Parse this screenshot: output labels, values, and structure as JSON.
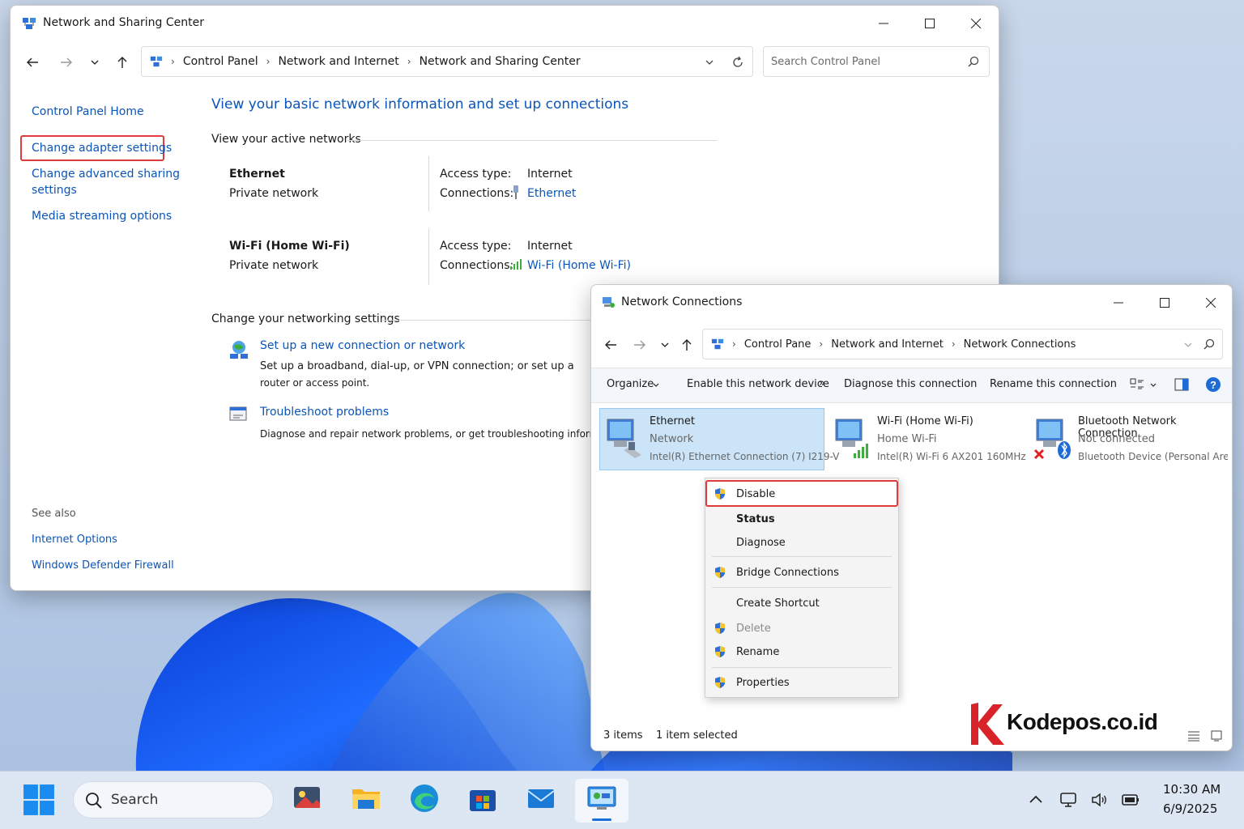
{
  "ns_window": {
    "title": "Network and Sharing Center",
    "breadcrumb": [
      "Control Panel",
      "Network and Internet",
      "Network and Sharing Center"
    ],
    "search_placeholder": "Search Control Panel",
    "sidebar": {
      "home": "Control Panel Home",
      "links": [
        "Change adapter settings",
        "Change advanced sharing",
        "settings",
        "Media streaming options"
      ],
      "see_also_header": "See also",
      "see_also": [
        "Internet Options",
        "Windows Defender Firewall"
      ]
    },
    "heading": "View your basic network information and set up connections",
    "active_networks_header": "View your active networks",
    "networks": [
      {
        "name": "Ethernet",
        "type": "Private network",
        "access_label": "Access type:",
        "access_value": "Internet",
        "conn_label": "Connections:",
        "conn_value": "Ethernet"
      },
      {
        "name": "Wi-Fi (Home Wi-Fi)",
        "type": "Private network",
        "access_label": "Access type:",
        "access_value": "Internet",
        "conn_label": "Connections:",
        "conn_value": "Wi-Fi (Home Wi-Fi)"
      }
    ],
    "settings_header": "Change your networking settings",
    "tasks": [
      {
        "title": "Set up a new connection or network",
        "desc1": "Set up a broadband, dial-up, or VPN connection; or set up a",
        "desc2": "router or access point."
      },
      {
        "title": "Troubleshoot problems",
        "desc1": "Diagnose and repair network problems, or get troubleshooting information.",
        "desc2": ""
      }
    ]
  },
  "nc_window": {
    "title": "Network Connections",
    "breadcrumb": [
      "Control Pane",
      "Network and Internet",
      "Network Connections"
    ],
    "commands": [
      "Organize",
      "Enable this network device",
      "»",
      "Diagnose this connection",
      "Rename this connection"
    ],
    "adapters": [
      {
        "name": "Ethernet",
        "status": "Network",
        "device": "Intel(R) Ethernet Connection (7) I219-V"
      },
      {
        "name": "Wi-Fi (Home Wi-Fi)",
        "status": "Home Wi-Fi",
        "device": "Intel(R) Wi-Fi 6 AX201 160MHz"
      },
      {
        "name": "Bluetooth Network Connection",
        "status": "Not connected",
        "device": "Bluetooth Device (Personal Area ..."
      }
    ],
    "context_menu": [
      "Disable",
      "Status",
      "Diagnose",
      "Bridge Connections",
      "Create Shortcut",
      "Delete",
      "Rename",
      "Properties"
    ],
    "status_bar": {
      "items": "3 items",
      "selected": "1 item selected"
    },
    "watermark": "Kodepos.co.id",
    "watermark_letter": "K"
  },
  "taskbar": {
    "search": "Search",
    "time": "10:30 AM",
    "date": "6/9/2025"
  },
  "colors": {
    "link": "#0b55b8",
    "highlight": "#e03a3a",
    "selection": "#cce4f7"
  }
}
